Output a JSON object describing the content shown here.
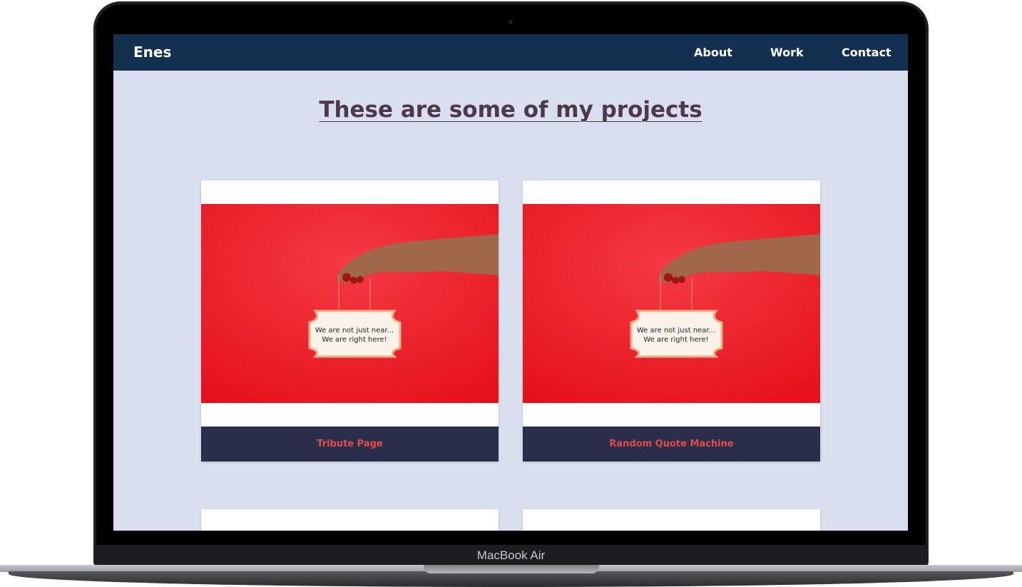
{
  "device": {
    "label": "MacBook Air"
  },
  "navbar": {
    "brand": "Enes",
    "links": [
      {
        "label": "About"
      },
      {
        "label": "Work"
      },
      {
        "label": "Contact"
      }
    ]
  },
  "main": {
    "heading": "These are some of my projects",
    "projects": [
      {
        "title": "Tribute Page",
        "sign_text": [
          "We are not just near...",
          "We are right here!"
        ]
      },
      {
        "title": "Random Quote Machine",
        "sign_text": [
          "We are not just near...",
          "We are right here!"
        ]
      },
      {
        "title": ""
      },
      {
        "title": ""
      }
    ]
  },
  "colors": {
    "navbar_bg": "#143050",
    "page_bg": "#d9dfee",
    "heading": "#4a3a4a",
    "card_title_bg": "#2b2e48",
    "card_title_text": "#e24b4b",
    "image_red": "#e8141c"
  }
}
